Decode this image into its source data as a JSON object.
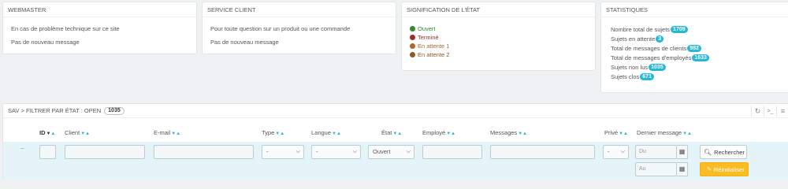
{
  "webmaster": {
    "title": "WEBMASTER",
    "line1": "En cas de problème technique sur ce site",
    "line2": "Pas de nouveau message"
  },
  "service_client": {
    "title": "SERVICE CLIENT",
    "line1": "Pour toute question sur un produit ou une commande",
    "line2": "Pas de nouveau message"
  },
  "signification": {
    "title": "SIGNIFICATION DE L'ÉTAT",
    "items": [
      {
        "label": "Ouvert",
        "color": "#2f8a2f"
      },
      {
        "label": "Terminé",
        "color": "#a12a2a"
      },
      {
        "label": "En attente 1",
        "color": "#a8692a"
      },
      {
        "label": "En attente 2",
        "color": "#8a5a24"
      }
    ]
  },
  "statistiques": {
    "title": "STATISTIQUES",
    "rows": [
      {
        "label": "Nombre total de sujets",
        "value": "1709"
      },
      {
        "label": "Sujets en attente",
        "value": "3"
      },
      {
        "label": "Total de messages de clients",
        "value": "982"
      },
      {
        "label": "Total de messages d'employés",
        "value": "1633"
      },
      {
        "label": "Sujets non lus",
        "value": "1035"
      },
      {
        "label": "Sujets clos",
        "value": "671"
      }
    ]
  },
  "list": {
    "breadcrumb": "SAV > FILTRER PAR ÉTAT : OPEN",
    "count": "1035",
    "columns": {
      "id": "ID",
      "client": "Client",
      "email": "E-mail",
      "type": "Type",
      "langue": "Langue",
      "etat": "État",
      "employe": "Employé",
      "messages": "Messages",
      "prive": "Privé",
      "dernier_message": "Dernier message"
    },
    "filters": {
      "dash": "--",
      "type_value": "-",
      "langue_value": "-",
      "etat_value": "Ouvert",
      "prive_value": "-",
      "date_from_placeholder": "Du",
      "date_to_placeholder": "Au"
    },
    "buttons": {
      "search": "Rechercher",
      "reset": "Réinitialiser"
    }
  }
}
